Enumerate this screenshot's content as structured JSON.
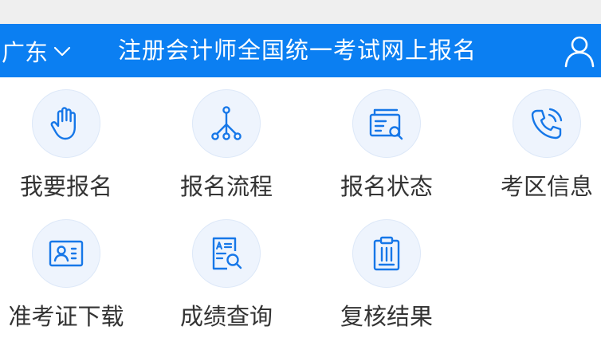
{
  "header": {
    "region": "广东",
    "title": "注册会计师全国统一考试网上报名"
  },
  "menu": [
    {
      "label": "我要报名",
      "icon": "hand-icon"
    },
    {
      "label": "报名流程",
      "icon": "flow-icon"
    },
    {
      "label": "报名状态",
      "icon": "status-icon"
    },
    {
      "label": "考区信息",
      "icon": "phone-icon"
    },
    {
      "label": "准考证下载",
      "icon": "id-card-icon"
    },
    {
      "label": "成绩查询",
      "icon": "score-search-icon"
    },
    {
      "label": "复核结果",
      "icon": "clipboard-icon"
    }
  ],
  "colors": {
    "header_bg": "#0b7ff2",
    "icon_blue": "#1677e8",
    "icon_circle_bg": "#eef4fd",
    "label_text": "#333333"
  }
}
